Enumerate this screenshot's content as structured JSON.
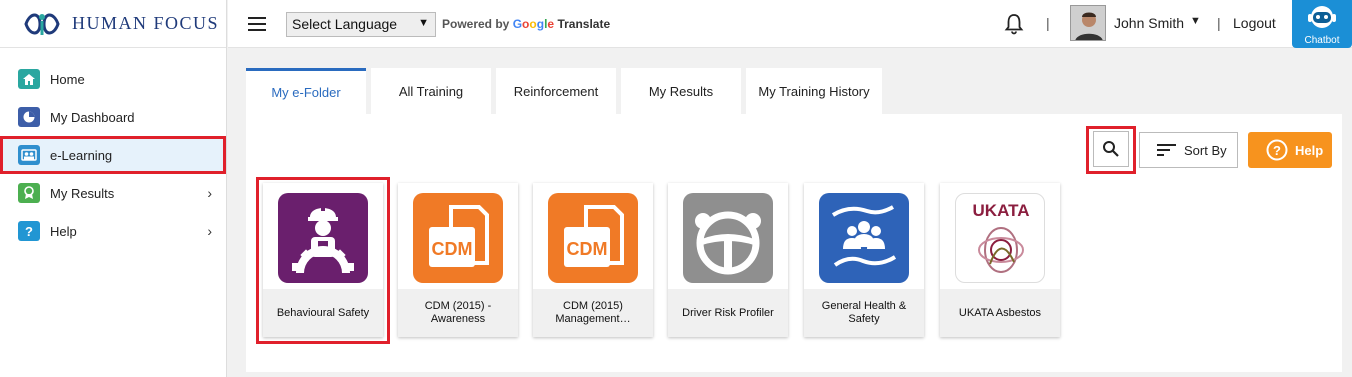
{
  "brand": {
    "name": "HUMAN FOCUS"
  },
  "sidebar": {
    "items": [
      {
        "label": "Home",
        "icon": "home-icon",
        "color": "#2aa7a0"
      },
      {
        "label": "My Dashboard",
        "icon": "dashboard-icon",
        "color": "#3d5ea8"
      },
      {
        "label": "e-Learning",
        "icon": "elearning-icon",
        "color": "#2f8fce"
      },
      {
        "label": "My Results",
        "icon": "results-icon",
        "color": "#4caf50"
      },
      {
        "label": "Help",
        "icon": "help-icon",
        "color": "#2196d3"
      }
    ]
  },
  "header": {
    "language_select": "Select Language",
    "powered_by": "Powered by",
    "google": "Google",
    "translate": "Translate",
    "user_name": "John Smith",
    "logout": "Logout",
    "chatbot": "Chatbot"
  },
  "tabs": [
    "My e-Folder",
    "All Training",
    "Reinforcement",
    "My Results",
    "My Training History"
  ],
  "toolbar": {
    "sort_by": "Sort By",
    "help": "Help"
  },
  "courses": [
    {
      "title": "Behavioural Safety",
      "icon": "worker-gear-icon",
      "color": "#6a1f6d"
    },
    {
      "title": "CDM (2015) - Awareness",
      "icon": "cdm-document-icon",
      "color": "#f07a26",
      "badge": "CDM"
    },
    {
      "title": "CDM (2015) Management…",
      "icon": "cdm-document-icon",
      "color": "#f07a26",
      "badge": "CDM"
    },
    {
      "title": "Driver Risk Profiler",
      "icon": "steering-wheel-icon",
      "color": "#8f8f8f"
    },
    {
      "title": "General Health & Safety",
      "icon": "people-hands-icon",
      "color": "#2e63b8"
    },
    {
      "title": "UKATA Asbestos",
      "icon": "ukata-logo-icon",
      "color": "#ffffff",
      "badge": "UKATA"
    }
  ],
  "colors": {
    "accent": "#2a6bbf",
    "help_button": "#f7931e",
    "highlight": "#e0202b",
    "chatbot": "#1b8fd6"
  }
}
